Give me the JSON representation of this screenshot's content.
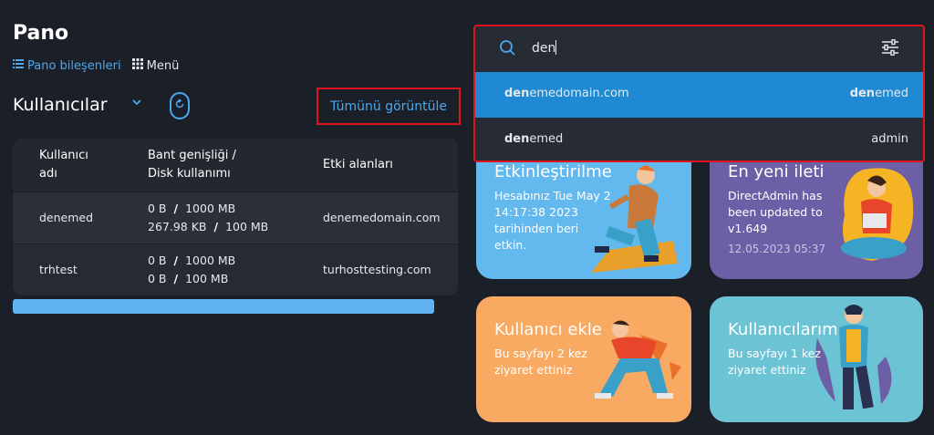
{
  "header": {
    "title": "Pano",
    "link_components": "Pano bileşenleri",
    "link_menu": "Menü"
  },
  "users_section": {
    "title": "Kullanıcılar",
    "view_all": "Tümünü görüntüle",
    "columns": [
      "Kullanıcı adı",
      "Bant genişliği / Disk kullanımı",
      "Etki alanları"
    ],
    "col1_line1": "Kullanıcı",
    "col1_line2": "adı",
    "col2_line1": "Bant genişliği /",
    "col2_line2": "Disk kullanımı",
    "col3": "Etki alanları",
    "rows": [
      {
        "user": "denemed",
        "bw_used": "0 B",
        "bw_limit": "1000 MB",
        "disk_used": "267.98 KB",
        "disk_limit": "100 MB",
        "domain": "denemedomain.com"
      },
      {
        "user": "trhtest",
        "bw_used": "0 B",
        "bw_limit": "1000 MB",
        "disk_used": "0 B",
        "disk_limit": "100 MB",
        "domain": "turhosttesting.com"
      }
    ]
  },
  "cards": {
    "activation": {
      "title": "Etkinleştirilme",
      "l1": "Hesabınız Tue May 2",
      "l2": "14:17:38 2023",
      "l3": "tarihinden beri",
      "l4": "etkin."
    },
    "latest": {
      "title": "En yeni ileti",
      "l1": "DirectAdmin has",
      "l2": "been updated to",
      "l3": "v1.649",
      "date": "12.05.2023 05:37"
    },
    "user_add": {
      "title": "Kullanıcı ekle",
      "l1": "Bu sayfayı 2 kez",
      "l2": "ziyaret ettiniz"
    },
    "my_users": {
      "title": "Kullanıcılarım",
      "l1": "Bu sayfayı 1 kez",
      "l2": "ziyaret ettiniz"
    }
  },
  "search": {
    "query": "den",
    "results": [
      {
        "match": "den",
        "rest": "emedomain.com",
        "right_match": "den",
        "right_rest": "emed"
      },
      {
        "match": "den",
        "rest": "emed",
        "right": "admin"
      }
    ]
  },
  "colors": {
    "accent": "#4aa8f0",
    "highlight_border": "#e0141f",
    "card_blue": "#63b8ee",
    "card_purple": "#6d5fa6",
    "card_orange": "#f8a962",
    "card_teal": "#6cc3d4"
  },
  "icons": [
    "list-icon",
    "grid-icon",
    "chevron-down-icon",
    "refresh-icon",
    "search-icon",
    "filter-icon"
  ]
}
